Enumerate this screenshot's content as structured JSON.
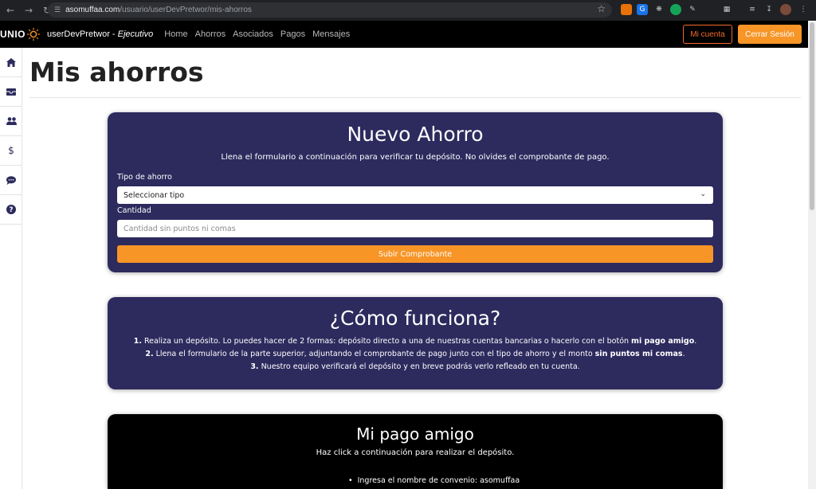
{
  "browser": {
    "url_host": "asomuffaa.com",
    "url_path": "/usuario/userDevPretwor/mis-ahorros"
  },
  "navbar": {
    "logo_text": "UNIO",
    "user": "userDevPretwor",
    "role": "Ejecutivo",
    "links": [
      "Home",
      "Ahorros",
      "Asociados",
      "Pagos",
      "Mensajes"
    ],
    "mi_cuenta": "Mi cuenta",
    "cerrar_sesion": "Cerrar Sesión"
  },
  "sidebar": {
    "icons": [
      "home-icon",
      "inbox-icon",
      "users-icon",
      "dollar-icon",
      "chat-icon",
      "help-icon"
    ]
  },
  "page": {
    "title": "Mis ahorros"
  },
  "nuevo_ahorro": {
    "title": "Nuevo Ahorro",
    "subtitle": "Llena el formulario a continuación para verificar tu depósito. No olvides el comprobante de pago.",
    "tipo_label": "Tipo de ahorro",
    "tipo_value": "Seleccionar tipo",
    "cantidad_label": "Cantidad",
    "cantidad_placeholder": "Cantidad sin puntos ni comas",
    "submit_label": "Subir Comprobante"
  },
  "como_funciona": {
    "title": "¿Cómo funciona?",
    "step1_num": "1.",
    "step1_text": " Realiza un depósito. Lo puedes hacer de 2 formas: depósito directo a una de nuestras cuentas bancarias o hacerlo con el botón ",
    "step1_bold": "mi pago amigo",
    "step1_end": ".",
    "step2_num": "2.",
    "step2_text": " Llena el formulario de la parte superior, adjuntando el comprobante de pago junto con el tipo de ahorro y el monto ",
    "step2_bold": "sin puntos mi comas",
    "step2_end": ".",
    "step3_num": "3.",
    "step3_text": " Nuestro equipo verificará el depósito y en breve podrás verlo refleado en tu cuenta."
  },
  "mi_pago_amigo": {
    "title": "Mi pago amigo",
    "subtitle": "Haz click a continuación para realizar el depósito.",
    "item1": "Ingresa el nombre de convenio: asomuffaa"
  },
  "colors": {
    "card_primary": "#2d2a5e",
    "accent_orange": "#f79526",
    "outline_orange": "#f36b2b"
  }
}
